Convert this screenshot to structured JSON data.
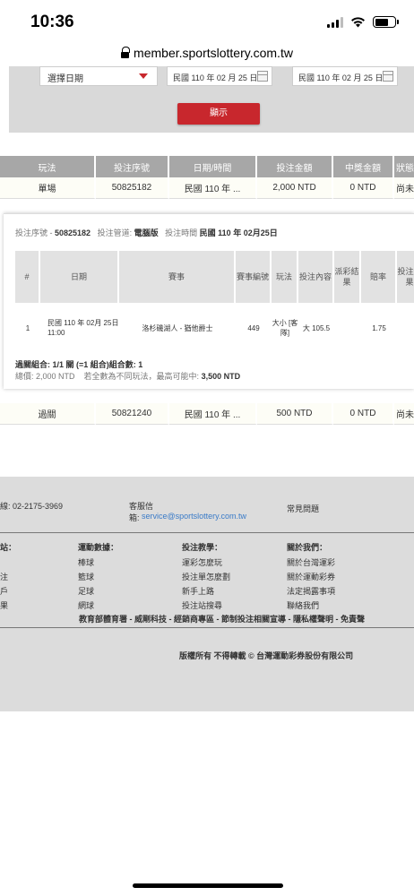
{
  "status_bar": {
    "time": "10:36"
  },
  "browser": {
    "url": "member.sportslottery.com.tw"
  },
  "search": {
    "date_select": "選擇日期",
    "start_date": "民國 110 年 02 月 25 日",
    "end_date": "民國 110 年 02 月 25 日",
    "query_button": "顯示"
  },
  "colors": {
    "accent_red": "#c8272d",
    "header_gray": "#a7a7a7",
    "link_blue": "#3a7bc8"
  },
  "bets_table": {
    "headers": [
      "玩法",
      "投注序號",
      "日期/時間",
      "投注金額",
      "中獎金額",
      "狀態"
    ],
    "rows": [
      [
        "單場",
        "50825182",
        "民國 110 年 ...",
        "2,000 NTD",
        "0 NTD",
        "尚未"
      ],
      [
        "過關",
        "50821240",
        "民國 110 年 ...",
        "500 NTD",
        "0 NTD",
        "尚未"
      ]
    ]
  },
  "bet_detail": {
    "serial_label": "投注序號 -",
    "serial_value": "50825182",
    "channel_label": "投注管道:",
    "channel_value": "電腦版",
    "time_label": "投注時間",
    "time_value": "民國 110 年 02月25日",
    "headers": [
      "#",
      "日期",
      "賽事",
      "賽事編號",
      "玩法",
      "投注內容",
      "派彩結果",
      "賠率",
      "投注結果"
    ],
    "rows": [
      [
        "1",
        "民國 110 年 02月 25日 11:00",
        "洛杉磯湖人 - 猶他爵士",
        "449",
        "大小 [客隊]",
        "大 105.5",
        "",
        "1.75",
        ""
      ]
    ],
    "combo_text": "過關組合: 1/1 關 (=1 組合)組合數: 1",
    "total_label": "總價: 2,000 NTD",
    "max_win_label": "若全數為不同玩法，最高可能中:",
    "max_win_value": "3,500 NTD"
  },
  "footer": {
    "hotline": "線: 02-2175-3969",
    "service_label": "客服信",
    "service_label2": "箱:",
    "service_email": "service@sportslottery.com.tw",
    "faq": "常見問題",
    "col1": {
      "title": "站：",
      "items": [
        "注",
        "戶",
        "果"
      ]
    },
    "col2": {
      "title": "運動數據：",
      "items": [
        "棒球",
        "籃球",
        "足球",
        "網球"
      ]
    },
    "col3": {
      "title": "投注教學：",
      "items": [
        "運彩怎麼玩",
        "投注單怎麼劃",
        "新手上路",
        "投注站搜尋"
      ]
    },
    "col4": {
      "title": "關於我們：",
      "items": [
        "關於台灣運彩",
        "關於運動彩券",
        "法定揭露事項",
        "聯絡我們"
      ]
    },
    "partners": "教育部體育署 - 威剛科技 - 經銷商專區 - 節制投注相關宣導 - 隱私權聲明 - 免責聲",
    "copyright": "版權所有 不得轉載 © 台灣運動彩券股份有限公司"
  }
}
